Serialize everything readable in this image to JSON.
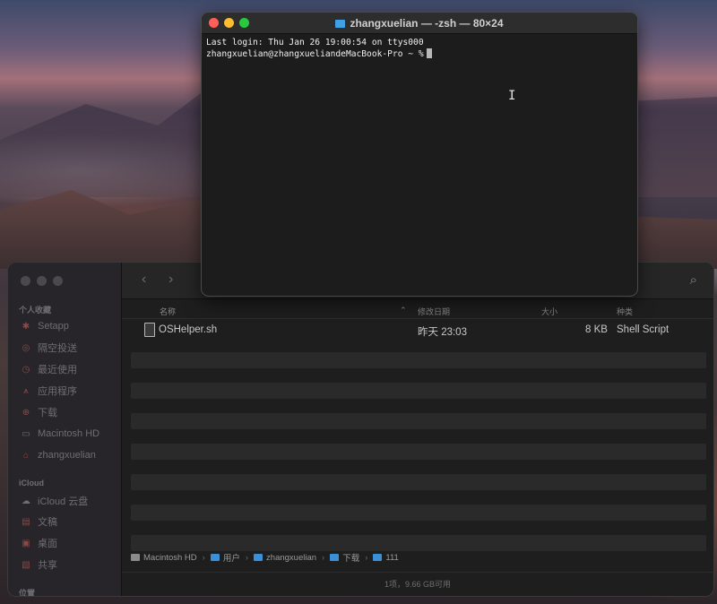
{
  "terminal": {
    "title": "zhangxuelian — -zsh — 80×24",
    "lines": [
      "Last login: Thu Jan 26 19:00:54 on ttys000",
      "zhangxuelian@zhangxueliandeMacBook-Pro ~ %"
    ]
  },
  "finder": {
    "sidebar": {
      "favorites_header": "个人收藏",
      "favorites": [
        {
          "label": "Setapp",
          "icon": "setapp-icon"
        },
        {
          "label": "隔空投送",
          "icon": "airdrop-icon"
        },
        {
          "label": "最近使用",
          "icon": "clock-icon"
        },
        {
          "label": "应用程序",
          "icon": "applications-icon"
        },
        {
          "label": "下载",
          "icon": "download-icon"
        },
        {
          "label": "Macintosh HD",
          "icon": "disk-icon"
        },
        {
          "label": "zhangxuelian",
          "icon": "home-icon"
        }
      ],
      "icloud_header": "iCloud",
      "icloud": [
        {
          "label": "iCloud 云盘",
          "icon": "cloud-icon"
        },
        {
          "label": "文稿",
          "icon": "document-icon"
        },
        {
          "label": "桌面",
          "icon": "desktop-icon"
        },
        {
          "label": "共享",
          "icon": "shared-folder-icon"
        }
      ],
      "locations_header": "位置"
    },
    "columns": {
      "name": "名称",
      "modified": "修改日期",
      "size": "大小",
      "kind": "种类"
    },
    "files": [
      {
        "name": "OSHelper.sh",
        "modified": "昨天 23:03",
        "size": "8 KB",
        "kind": "Shell Script"
      }
    ],
    "path": [
      "Macintosh HD",
      "用户",
      "zhangxuelian",
      "下载",
      "111"
    ],
    "status": "1项，9.66 GB可用",
    "colors": {
      "terminal_bg": "#1c1c1c",
      "folder_blue": "#3b8fd6"
    }
  }
}
